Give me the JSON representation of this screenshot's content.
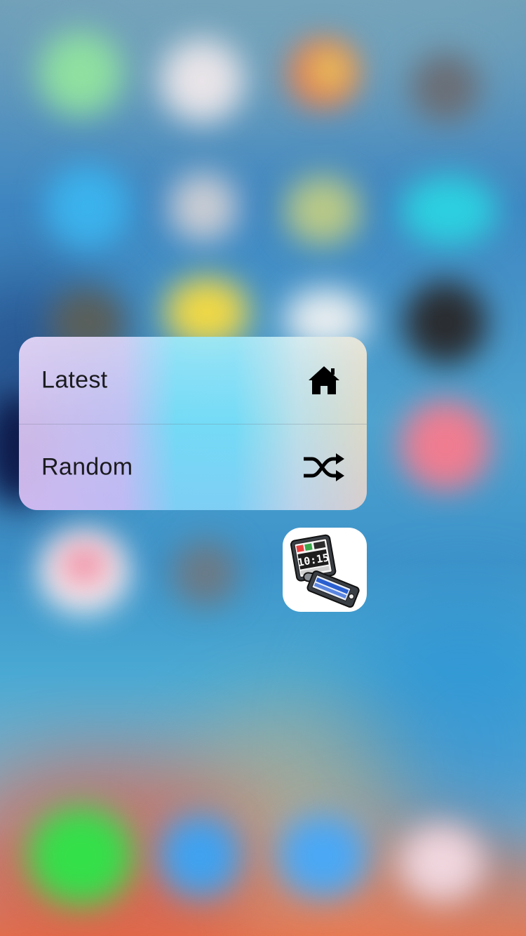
{
  "quick_actions": [
    {
      "label": "Latest",
      "icon": "house-icon"
    },
    {
      "label": "Random",
      "icon": "shuffle-icon"
    }
  ],
  "app_icon": {
    "name": "flip-phone-clock-app-icon",
    "clock_text": "10:15"
  },
  "colors": {
    "menu_text": "#1b1b1f",
    "icon_fill": "#000000"
  }
}
